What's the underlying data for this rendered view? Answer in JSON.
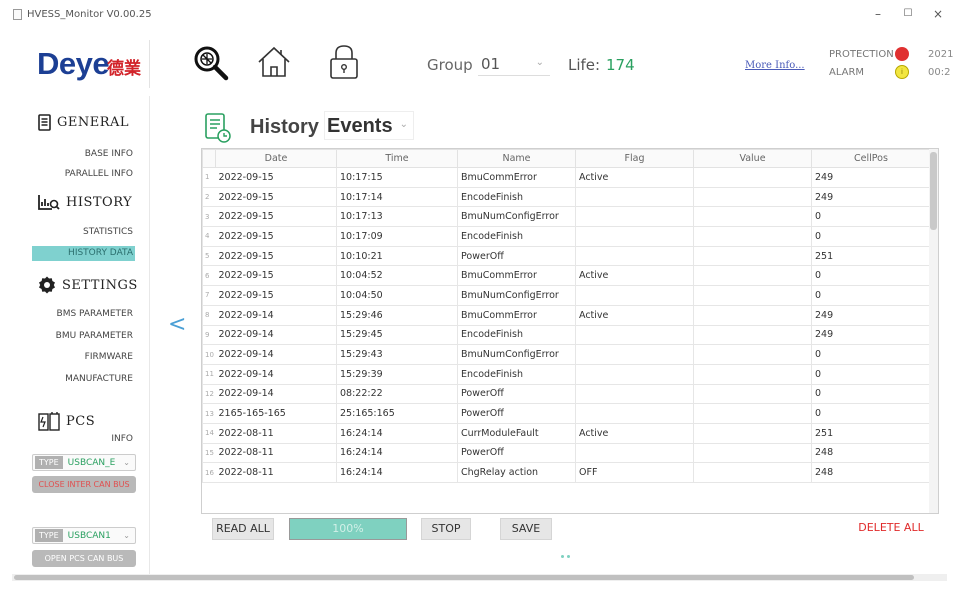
{
  "window": {
    "title": "HVESS_Monitor V0.00.25",
    "minimize": "–",
    "maximize": "☐",
    "close": "×"
  },
  "brand": {
    "logo": "Deye",
    "logo_cn": "德業",
    "accent": "#1c3f94",
    "cn_color": "#d2232a"
  },
  "toolbar": {
    "icons": [
      "search-scan-icon",
      "home-icon",
      "lock-icon"
    ],
    "group_label": "Group",
    "group_value": "01",
    "life_label": "Life:",
    "life_value": "174",
    "more_info": "More Info...",
    "protection_label": "PROTECTION",
    "alarm_label": "ALARM",
    "alarm_glyph": "i",
    "date_fragment": "2021",
    "time_fragment": "00:2",
    "protection_color": "#e03030",
    "alarm_color": "#f2e640"
  },
  "sidebar": {
    "general": {
      "label": "GENERAL",
      "items": [
        "BASE INFO",
        "PARALLEL INFO"
      ]
    },
    "history": {
      "label": "HISTORY",
      "items": [
        "STATISTICS",
        "HISTORY DATA"
      ],
      "active": "HISTORY DATA"
    },
    "settings": {
      "label": "SETTINGS",
      "items": [
        "BMS PARAMETER",
        "BMU PARAMETER",
        "FIRMWARE",
        "MANUFACTURE"
      ]
    },
    "pcs": {
      "label": "PCS",
      "items": [
        "INFO"
      ]
    },
    "type1": {
      "tag": "TYPE",
      "value": "USBCAN_E"
    },
    "can1": {
      "label": "CLOSE INTER CAN BUS",
      "color": "#e05050"
    },
    "type2": {
      "tag": "TYPE",
      "value": "USBCAN1"
    },
    "can2": {
      "label": "OPEN PCS CAN BUS",
      "color": "#ffffff"
    }
  },
  "main": {
    "title": "History",
    "select_value": "Events",
    "back": "<",
    "columns": [
      "Date",
      "Time",
      "Name",
      "Flag",
      "Value",
      "CellPos"
    ],
    "rows": [
      {
        "n": "1",
        "date": "2022-09-15",
        "time": "10:17:15",
        "name": "BmuCommError",
        "flag": "Active",
        "value": "",
        "cellpos": "249"
      },
      {
        "n": "2",
        "date": "2022-09-15",
        "time": "10:17:14",
        "name": "EncodeFinish",
        "flag": "",
        "value": "",
        "cellpos": "249"
      },
      {
        "n": "3",
        "date": "2022-09-15",
        "time": "10:17:13",
        "name": "BmuNumConfigError",
        "flag": "",
        "value": "",
        "cellpos": "0"
      },
      {
        "n": "4",
        "date": "2022-09-15",
        "time": "10:17:09",
        "name": "EncodeFinish",
        "flag": "",
        "value": "",
        "cellpos": "0"
      },
      {
        "n": "5",
        "date": "2022-09-15",
        "time": "10:10:21",
        "name": "PowerOff",
        "flag": "",
        "value": "",
        "cellpos": "251"
      },
      {
        "n": "6",
        "date": "2022-09-15",
        "time": "10:04:52",
        "name": "BmuCommError",
        "flag": "Active",
        "value": "",
        "cellpos": "0"
      },
      {
        "n": "7",
        "date": "2022-09-15",
        "time": "10:04:50",
        "name": "BmuNumConfigError",
        "flag": "",
        "value": "",
        "cellpos": "0"
      },
      {
        "n": "8",
        "date": "2022-09-14",
        "time": "15:29:46",
        "name": "BmuCommError",
        "flag": "Active",
        "value": "",
        "cellpos": "249"
      },
      {
        "n": "9",
        "date": "2022-09-14",
        "time": "15:29:45",
        "name": "EncodeFinish",
        "flag": "",
        "value": "",
        "cellpos": "249"
      },
      {
        "n": "10",
        "date": "2022-09-14",
        "time": "15:29:43",
        "name": "BmuNumConfigError",
        "flag": "",
        "value": "",
        "cellpos": "0"
      },
      {
        "n": "11",
        "date": "2022-09-14",
        "time": "15:29:39",
        "name": "EncodeFinish",
        "flag": "",
        "value": "",
        "cellpos": "0"
      },
      {
        "n": "12",
        "date": "2022-09-14",
        "time": "08:22:22",
        "name": "PowerOff",
        "flag": "",
        "value": "",
        "cellpos": "0"
      },
      {
        "n": "13",
        "date": "2165-165-165",
        "time": "25:165:165",
        "name": "PowerOff",
        "flag": "",
        "value": "",
        "cellpos": "0"
      },
      {
        "n": "14",
        "date": "2022-08-11",
        "time": "16:24:14",
        "name": "CurrModuleFault",
        "flag": "Active",
        "value": "",
        "cellpos": "251"
      },
      {
        "n": "15",
        "date": "2022-08-11",
        "time": "16:24:14",
        "name": "PowerOff",
        "flag": "",
        "value": "",
        "cellpos": "248"
      },
      {
        "n": "16",
        "date": "2022-08-11",
        "time": "16:24:14",
        "name": "ChgRelay action",
        "flag": "OFF",
        "value": "",
        "cellpos": "248"
      }
    ],
    "buttons": {
      "read_all": "READ ALL",
      "progress": "100%",
      "stop": "STOP",
      "save": "SAVE",
      "delete_all": "DELETE ALL"
    }
  }
}
